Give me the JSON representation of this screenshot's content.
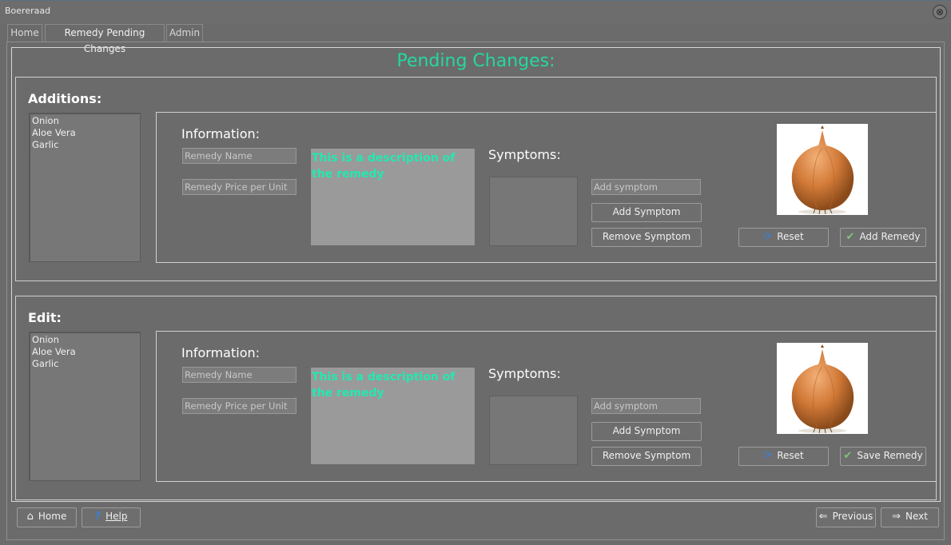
{
  "window": {
    "title": "Boereraad",
    "close_glyph": "⊗"
  },
  "tabs": [
    {
      "label": "Home"
    },
    {
      "label": "Remedy Pending Changes"
    },
    {
      "label": "Admin"
    }
  ],
  "page_title": "Pending Changes:",
  "additions": {
    "label": "Additions:",
    "list": [
      "Onion",
      "Aloe Vera",
      "Garlic"
    ],
    "info_label": "Information:",
    "name_placeholder": "Remedy Name",
    "price_placeholder": "Remedy Price per Unit",
    "description": "This is a description of the remedy",
    "symptoms_label": "Symptoms:",
    "symptom_placeholder": "Add symptom",
    "add_symptom": "Add Symptom",
    "remove_symptom": "Remove Symptom",
    "reset": "Reset",
    "confirm": "Add Remedy"
  },
  "edit": {
    "label": "Edit:",
    "list": [
      "Onion",
      "Aloe Vera",
      "Garlic"
    ],
    "info_label": "Information:",
    "name_placeholder": "Remedy Name",
    "price_placeholder": "Remedy Price per Unit",
    "description": "This is a description of the remedy",
    "symptoms_label": "Symptoms:",
    "symptom_placeholder": "Add symptom",
    "add_symptom": "Add Symptom",
    "remove_symptom": "Remove Symptom",
    "reset": "Reset",
    "confirm": "Save Remedy"
  },
  "footer": {
    "home": "Home",
    "help": "Help",
    "previous": "Previous",
    "next": "Next"
  },
  "colors": {
    "accent": "#24d8a0",
    "background": "#6b6b6b"
  },
  "icons": [
    "home-icon",
    "help-icon",
    "arrow-left-icon",
    "arrow-right-icon",
    "refresh-icon",
    "checkmark-icon",
    "onion-image"
  ]
}
